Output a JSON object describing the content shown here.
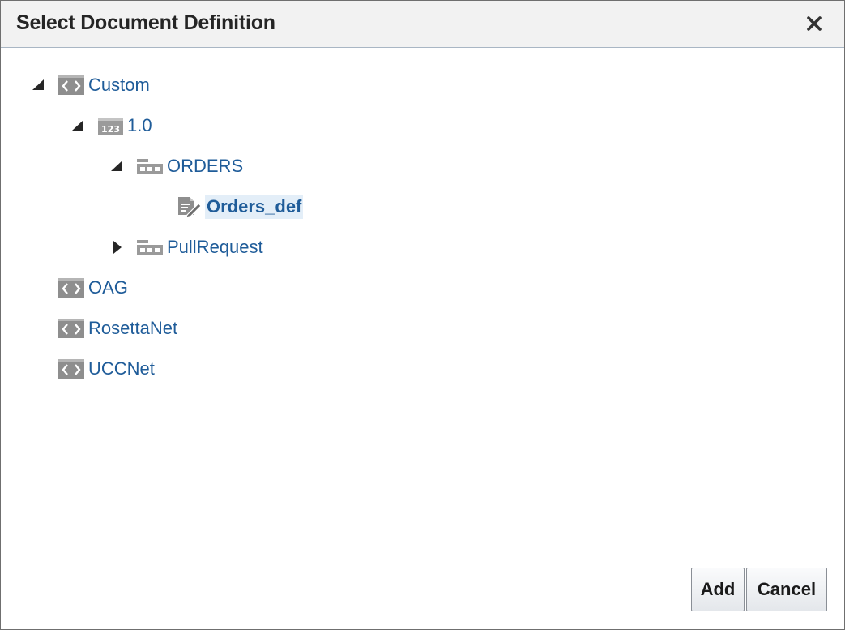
{
  "dialog": {
    "title": "Select Document Definition",
    "close_icon": "close-icon"
  },
  "tree": {
    "custom": {
      "label": "Custom",
      "icon": "protocol-icon",
      "expanded": true
    },
    "version": {
      "label": "1.0",
      "icon": "version-icon",
      "expanded": true
    },
    "orders": {
      "label": "ORDERS",
      "icon": "document-type-icon",
      "expanded": true
    },
    "orders_def": {
      "label": "Orders_def",
      "icon": "document-definition-icon",
      "selected": true
    },
    "pullrequest": {
      "label": "PullRequest",
      "icon": "document-type-icon",
      "expanded": false
    },
    "oag": {
      "label": "OAG",
      "icon": "protocol-icon"
    },
    "rosettanet": {
      "label": "RosettaNet",
      "icon": "protocol-icon"
    },
    "uccnet": {
      "label": "UCCNet",
      "icon": "protocol-icon"
    }
  },
  "buttons": {
    "add": "Add",
    "cancel": "Cancel"
  },
  "colors": {
    "link": "#1f5c99",
    "header_bg": "#f2f2f2",
    "icon_gray": "#8c8c8c"
  }
}
